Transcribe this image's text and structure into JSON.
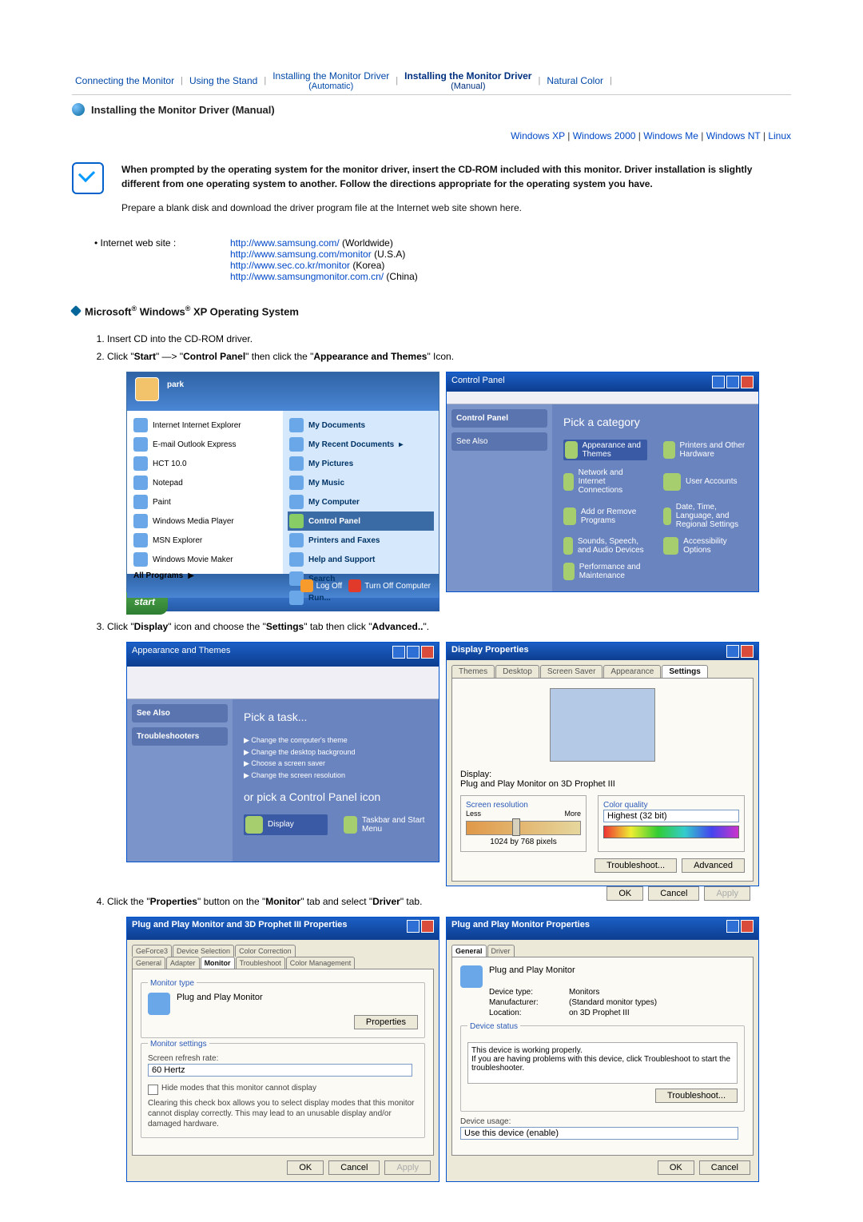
{
  "nav": {
    "items": [
      {
        "label": "Connecting the Monitor",
        "sub": "",
        "current": false
      },
      {
        "label": "Using the Stand",
        "sub": "",
        "current": false
      },
      {
        "label": "Installing the Monitor Driver",
        "sub": "(Automatic)",
        "current": false
      },
      {
        "label": "Installing the Monitor Driver",
        "sub": "(Manual)",
        "current": true
      },
      {
        "label": "Natural Color",
        "sub": "",
        "current": false
      }
    ],
    "sep": "|"
  },
  "subhead": "Installing the Monitor Driver (Manual)",
  "oslinks": {
    "items": [
      "Windows XP",
      "Windows 2000",
      "Windows Me",
      "Windows NT",
      "Linux"
    ],
    "sep": " | "
  },
  "intro": {
    "bold": "When prompted by the operating system for the monitor driver, insert the CD-ROM included with this monitor. Driver installation is slightly different from one operating system to another. Follow the directions appropriate for the operating system you have.",
    "plain": "Prepare a blank disk and download the driver program file at the Internet web site shown here."
  },
  "site": {
    "bullet_label": "Internet web site :",
    "links": [
      {
        "url": "http://www.samsung.com/",
        "suffix": " (Worldwide)"
      },
      {
        "url": "http://www.samsung.com/monitor",
        "suffix": " (U.S.A)"
      },
      {
        "url": "http://www.sec.co.kr/monitor",
        "suffix": " (Korea)"
      },
      {
        "url": "http://www.samsungmonitor.com.cn/",
        "suffix": " (China)"
      }
    ]
  },
  "section_title_html": "Microsoft® Windows® XP Operating System",
  "steps": {
    "s1": "Insert CD into the CD-ROM driver.",
    "s2_pre": "Click \"",
    "s2_start": "Start",
    "s2_mid": "\" —> \"",
    "s2_cp": "Control Panel",
    "s2_mid2": "\" then click the \"",
    "s2_theme": "Appearance and Themes",
    "s2_post": "\" Icon.",
    "s3_pre": "Click \"",
    "s3_display": "Display",
    "s3_mid": "\" icon and choose the \"",
    "s3_settings": "Settings",
    "s3_mid2": "\" tab then click \"",
    "s3_adv": "Advanced..",
    "s3_post": "\".",
    "s4_pre": "Click the \"",
    "s4_prop": "Properties",
    "s4_mid": "\" button on the \"",
    "s4_mon": "Monitor",
    "s4_mid2": "\" tab and select \"",
    "s4_drv": "Driver",
    "s4_post": "\" tab."
  },
  "startmenu": {
    "user": "park",
    "left": [
      "Internet\nInternet Explorer",
      "E-mail\nOutlook Express",
      "HCT 10.0",
      "Notepad",
      "Paint",
      "Windows Media Player",
      "MSN Explorer",
      "Windows Movie Maker",
      "All Programs"
    ],
    "right": [
      "My Documents",
      "My Recent Documents",
      "My Pictures",
      "My Music",
      "My Computer",
      "Control Panel",
      "Printers and Faxes",
      "Help and Support",
      "Search",
      "Run..."
    ],
    "log_off": "Log Off",
    "turn_off": "Turn Off Computer",
    "start": "start"
  },
  "cp": {
    "title": "Control Panel",
    "heading": "Pick a category",
    "cats": [
      "Appearance and Themes",
      "Printers and Other Hardware",
      "Network and Internet Connections",
      "User Accounts",
      "Add or Remove Programs",
      "Date, Time, Language, and Regional Settings",
      "Sounds, Speech, and Audio Devices",
      "Accessibility Options",
      "Performance and Maintenance"
    ]
  },
  "themes": {
    "title": "Appearance and Themes",
    "pick_task": "Pick a task...",
    "tasks": [
      "Change the computer's theme",
      "Change the desktop background",
      "Choose a screen saver",
      "Change the screen resolution"
    ],
    "or_pick": "or pick a Control Panel icon",
    "icons": [
      "Display",
      "Taskbar and Start Menu"
    ],
    "see_also": "See Also",
    "troubleshooters": "Troubleshooters"
  },
  "display_props": {
    "title": "Display Properties",
    "tabs": [
      "Themes",
      "Desktop",
      "Screen Saver",
      "Appearance",
      "Settings"
    ],
    "display_label": "Display:",
    "display_value": "Plug and Play Monitor on 3D Prophet III",
    "res_label": "Screen resolution",
    "less": "Less",
    "more": "More",
    "res_value": "1024 by 768 pixels",
    "color_label": "Color quality",
    "color_value": "Highest (32 bit)",
    "troubleshoot": "Troubleshoot...",
    "advanced": "Advanced",
    "ok": "OK",
    "cancel": "Cancel",
    "apply": "Apply"
  },
  "monitor_dlg": {
    "title": "Plug and Play Monitor and 3D Prophet III Properties",
    "tabs_row1": [
      "GeForce3",
      "Device Selection",
      "Color Correction"
    ],
    "tabs_row2": [
      "General",
      "Adapter",
      "Monitor",
      "Troubleshoot",
      "Color Management"
    ],
    "grp_type": "Monitor type",
    "type_value": "Plug and Play Monitor",
    "properties": "Properties",
    "grp_settings": "Monitor settings",
    "refresh_lbl": "Screen refresh rate:",
    "refresh_val": "60 Hertz",
    "hide_chk": "Hide modes that this monitor cannot display",
    "hide_text": "Clearing this check box allows you to select display modes that this monitor cannot display correctly. This may lead to an unusable display and/or damaged hardware.",
    "ok": "OK",
    "cancel": "Cancel",
    "apply": "Apply"
  },
  "driver_dlg": {
    "title": "Plug and Play Monitor Properties",
    "tabs": [
      "General",
      "Driver"
    ],
    "name": "Plug and Play Monitor",
    "kv": [
      {
        "k": "Device type:",
        "v": "Monitors"
      },
      {
        "k": "Manufacturer:",
        "v": "(Standard monitor types)"
      },
      {
        "k": "Location:",
        "v": "on 3D Prophet III"
      }
    ],
    "status_lbl": "Device status",
    "status_line1": "This device is working properly.",
    "status_line2": "If you are having problems with this device, click Troubleshoot to start the troubleshooter.",
    "troubleshoot": "Troubleshoot...",
    "usage_lbl": "Device usage:",
    "usage_val": "Use this device (enable)",
    "ok": "OK",
    "cancel": "Cancel"
  }
}
